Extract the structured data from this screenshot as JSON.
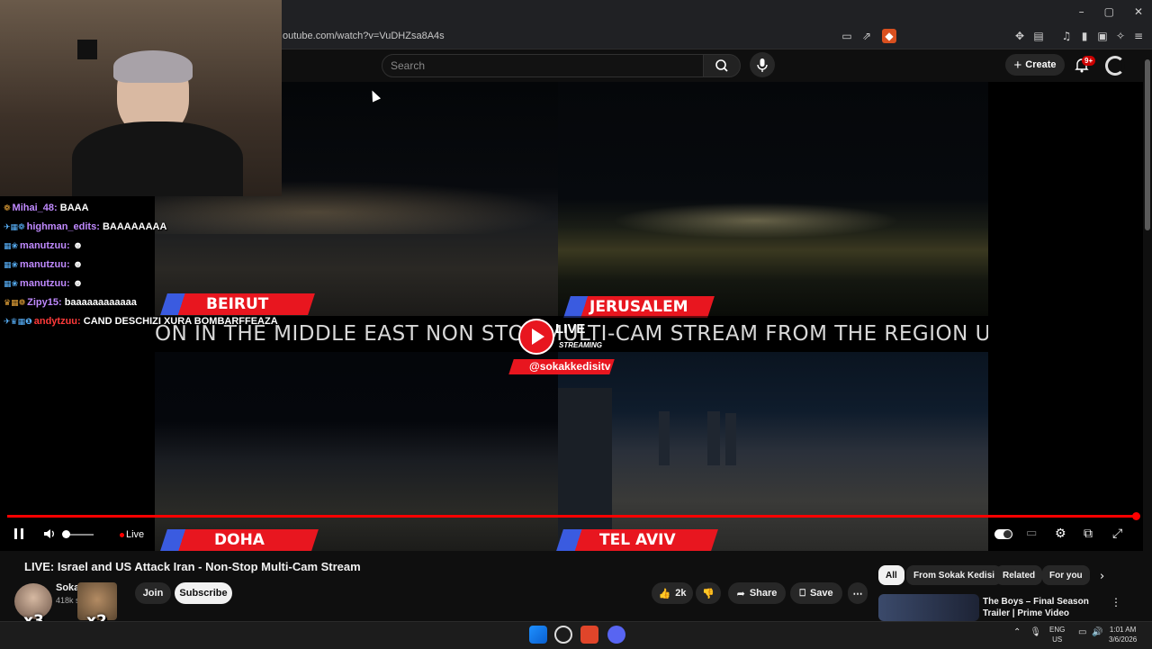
{
  "browser": {
    "url": "outube.com/watch?v=VuDHZsa8A4s",
    "window_controls": [
      "–",
      "▢",
      "✕"
    ]
  },
  "masthead": {
    "search_placeholder": "Search",
    "create_label": "Create",
    "notifications_badge": "9+"
  },
  "player": {
    "cities": [
      "BEIRUT",
      "JERUSALEM",
      "DOHA",
      "TEL AVIV"
    ],
    "ticker": "ON IN THE MIDDLE EAST NON STOP MULTI-CAM STREAM FROM THE REGION US IS",
    "live_badge": "LIVE",
    "streaming_badge": "STREAMING",
    "handle": "@sokakkedisitv",
    "controls": {
      "live_label": "Live"
    },
    "colors": {
      "accent": "#e8161f",
      "label_blue": "#3a5be0"
    }
  },
  "chat": [
    {
      "user": "Mihai_48:",
      "msg": "BAAA",
      "user_color": "#c08aff"
    },
    {
      "user": "highman_edits:",
      "msg": "BAAAAAAAA",
      "user_color": "#c08aff"
    },
    {
      "user": "manutzuu:",
      "msg": "",
      "user_color": "#c08aff"
    },
    {
      "user": "manutzuu:",
      "msg": "",
      "user_color": "#c08aff"
    },
    {
      "user": "manutzuu:",
      "msg": "",
      "user_color": "#c08aff"
    },
    {
      "user": "Zipy15:",
      "msg": "baaaaaaaaaaaa",
      "user_color": "#c08aff"
    },
    {
      "user": "andytzuu:",
      "msg": "CAND DESCHIZI XURA BOMBARFFEAZA",
      "user_color": "#ff3a3a"
    }
  ],
  "video": {
    "title": "LIVE: Israel and US Attack Iran - Non-Stop Multi-Cam Stream",
    "channel": "Soka",
    "subscribers": "418k s",
    "join_label": "Join",
    "subscribe_label": "Subscribe",
    "likes": "2k",
    "share_label": "Share",
    "save_label": "Save",
    "multipliers": [
      "x3",
      "x2"
    ]
  },
  "recommendations": {
    "chips": [
      "All",
      "From Sokak Kedisi",
      "Related",
      "For you"
    ],
    "first_title": "The Boys – Final Season Trailer | Prime Video"
  },
  "taskbar": {
    "lang_1": "ENG",
    "lang_2": "US",
    "time": "1:01 AM",
    "date": "3/6/2026"
  }
}
